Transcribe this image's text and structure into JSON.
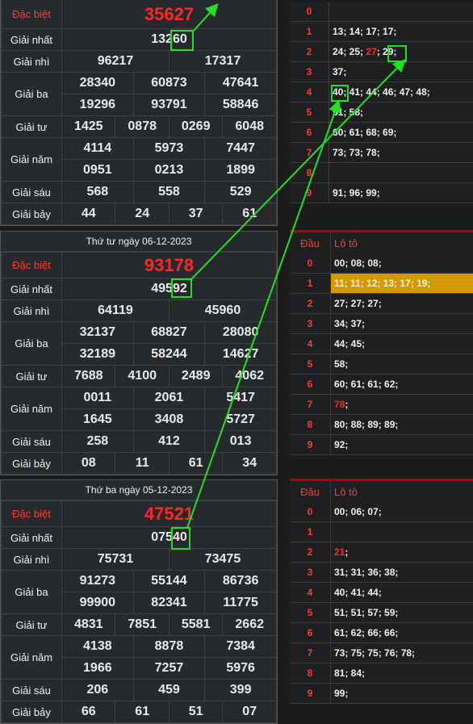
{
  "labels": {
    "db": "Đặc biệt",
    "g1": "Giải nhất",
    "g2": "Giải nhì",
    "g3": "Giải ba",
    "g4": "Giải tư",
    "g5": "Giải năm",
    "g6": "Giải sáu",
    "g7": "Giải bảy",
    "dau": "Đầu",
    "loto": "Lô tô"
  },
  "draws": [
    {
      "date": "",
      "db": "35627",
      "g1": "13260",
      "g2": [
        "96217",
        "17317"
      ],
      "g3": [
        "28340",
        "60873",
        "47641",
        "19296",
        "93791",
        "58846"
      ],
      "g4": [
        "1425",
        "0878",
        "0269",
        "6048"
      ],
      "g5": [
        "4114",
        "5973",
        "7447",
        "0951",
        "0213",
        "1899"
      ],
      "g6": [
        "568",
        "558",
        "529"
      ],
      "g7": [
        "44",
        "24",
        "37",
        "61"
      ]
    },
    {
      "date": "Thứ tư ngày 06-12-2023",
      "db": "93178",
      "g1": "49592",
      "g2": [
        "64119",
        "45960"
      ],
      "g3": [
        "32137",
        "68827",
        "28080",
        "32189",
        "58244",
        "14627"
      ],
      "g4": [
        "7688",
        "4100",
        "2489",
        "4062"
      ],
      "g5": [
        "0011",
        "2061",
        "5417",
        "1645",
        "3408",
        "5727"
      ],
      "g6": [
        "258",
        "412",
        "013"
      ],
      "g7": [
        "08",
        "11",
        "61",
        "34"
      ]
    },
    {
      "date": "Thứ ba ngày 05-12-2023",
      "db": "47521",
      "g1": "07540",
      "g2": [
        "75731",
        "73475"
      ],
      "g3": [
        "91273",
        "55144",
        "86736",
        "99900",
        "82341",
        "11775"
      ],
      "g4": [
        "4831",
        "7851",
        "5581",
        "2662"
      ],
      "g5": [
        "4138",
        "8878",
        "7384",
        "1966",
        "7257",
        "5976"
      ],
      "g6": [
        "206",
        "459",
        "399"
      ],
      "g7": [
        "66",
        "61",
        "51",
        "07"
      ]
    }
  ],
  "lotos": [
    {
      "show_header": false,
      "rows": [
        {
          "d": "0",
          "v": ""
        },
        {
          "d": "1",
          "v": "13; 14; 17; 17;"
        },
        {
          "d": "2",
          "v": "24; 25; ",
          "red": "27",
          "after": "; 29;"
        },
        {
          "d": "3",
          "v": "37;"
        },
        {
          "d": "4",
          "v": "40; 41; 44; 46; 47; 48;"
        },
        {
          "d": "5",
          "v": "51; 58;"
        },
        {
          "d": "6",
          "v": "60; 61; 68; 69;"
        },
        {
          "d": "7",
          "v": "73; 73; 78;"
        },
        {
          "d": "8",
          "v": ""
        },
        {
          "d": "9",
          "v": "91; 96; 99;"
        }
      ]
    },
    {
      "show_header": true,
      "rows": [
        {
          "d": "0",
          "v": "00; 08; 08;"
        },
        {
          "d": "1",
          "v": "11; 11; 12; 13; 17; 19;",
          "hl": true
        },
        {
          "d": "2",
          "v": "27; 27; 27;"
        },
        {
          "d": "3",
          "v": "34; 37;"
        },
        {
          "d": "4",
          "v": "44; 45;"
        },
        {
          "d": "5",
          "v": "58;"
        },
        {
          "d": "6",
          "v": "60; 61; 61; 62;"
        },
        {
          "d": "7",
          "v": "",
          "red": "78",
          "after": ";"
        },
        {
          "d": "8",
          "v": "80; 88; 89; 89;"
        },
        {
          "d": "9",
          "v": "92;"
        }
      ]
    },
    {
      "show_header": true,
      "rows": [
        {
          "d": "0",
          "v": "00; 06; 07;"
        },
        {
          "d": "1",
          "v": ""
        },
        {
          "d": "2",
          "v": "",
          "red": "21",
          "after": ";"
        },
        {
          "d": "3",
          "v": "31; 31; 36; 38;"
        },
        {
          "d": "4",
          "v": "40; 41; 44;"
        },
        {
          "d": "5",
          "v": "51; 51; 57; 59;"
        },
        {
          "d": "6",
          "v": "61; 62; 66; 66;"
        },
        {
          "d": "7",
          "v": "73; 75; 75; 76; 78;"
        },
        {
          "d": "8",
          "v": "81; 84;"
        },
        {
          "d": "9",
          "v": "99;"
        }
      ]
    }
  ],
  "colors": {
    "accent_red": "#ff2626",
    "arrow_green": "#22e022",
    "highlight": "#d39a00"
  }
}
